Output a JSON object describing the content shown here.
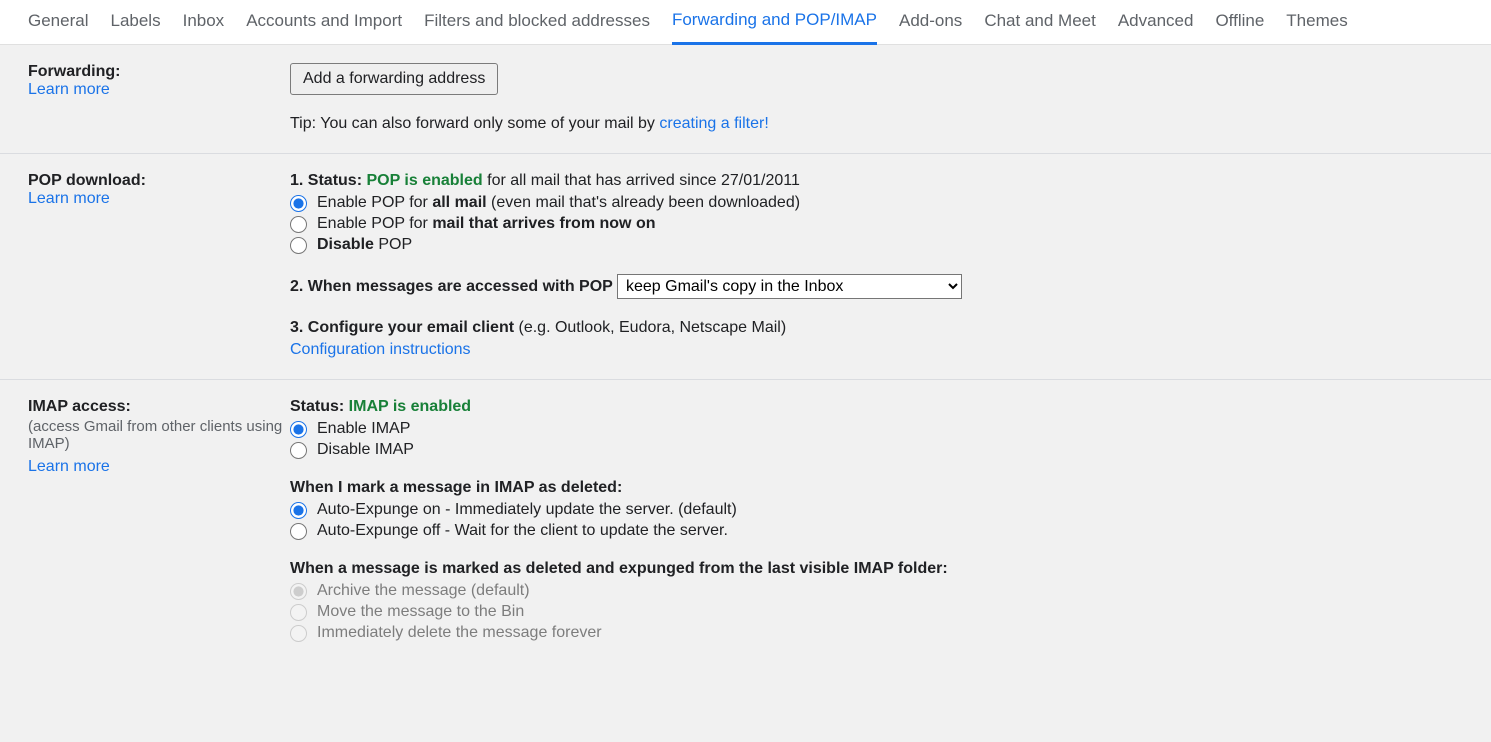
{
  "tabs": {
    "general": "General",
    "labels": "Labels",
    "inbox": "Inbox",
    "accounts": "Accounts and Import",
    "filters": "Filters and blocked addresses",
    "forwarding": "Forwarding and POP/IMAP",
    "addons": "Add-ons",
    "chat": "Chat and Meet",
    "advanced": "Advanced",
    "offline": "Offline",
    "themes": "Themes"
  },
  "common": {
    "learn_more": "Learn more"
  },
  "forwarding": {
    "heading": "Forwarding:",
    "add_button": "Add a forwarding address",
    "tip_prefix": "Tip: You can also forward only some of your mail by ",
    "tip_link": "creating a filter!"
  },
  "pop": {
    "heading": "POP download:",
    "status_prefix": "1. Status: ",
    "status_enabled": "POP is enabled",
    "status_suffix": " for all mail that has arrived since 27/01/2011",
    "opt_all_prefix": "Enable POP for ",
    "opt_all_bold": "all mail",
    "opt_all_suffix": " (even mail that's already been downloaded)",
    "opt_now_prefix": "Enable POP for ",
    "opt_now_bold": "mail that arrives from now on",
    "opt_disable_bold": "Disable",
    "opt_disable_suffix": " POP",
    "when_accessed": "2. When messages are accessed with POP ",
    "select_value": "keep Gmail's copy in the Inbox",
    "configure_bold": "3. Configure your email client",
    "configure_suffix": " (e.g. Outlook, Eudora, Netscape Mail)",
    "config_link": "Configuration instructions"
  },
  "imap": {
    "heading": "IMAP access:",
    "sub": "(access Gmail from other clients using IMAP)",
    "status_prefix": "Status: ",
    "status_enabled": "IMAP is enabled",
    "opt_enable": "Enable IMAP",
    "opt_disable": "Disable IMAP",
    "marked_deleted": "When I mark a message in IMAP as deleted:",
    "expunge_on": "Auto-Expunge on - Immediately update the server. (default)",
    "expunge_off": "Auto-Expunge off - Wait for the client to update the server.",
    "expunged_heading": "When a message is marked as deleted and expunged from the last visible IMAP folder:",
    "expunged_archive": "Archive the message (default)",
    "expunged_bin": "Move the message to the Bin",
    "expunged_delete": "Immediately delete the message forever"
  }
}
